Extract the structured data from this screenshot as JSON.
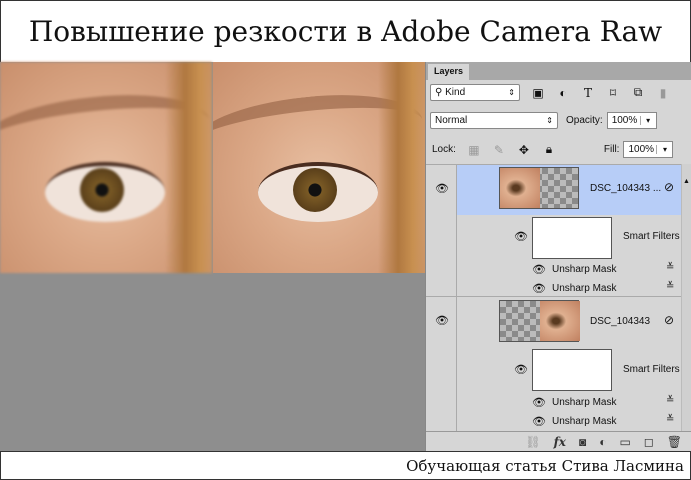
{
  "title": "Повышение резкости в Adobe Camera Raw",
  "caption": "Обучающая статья Стива Ласмина",
  "panel": {
    "tab": "Layers",
    "filter": "Kind",
    "blend_mode": "Normal",
    "opacity_label": "Opacity:",
    "opacity": "100%",
    "lock_label": "Lock:",
    "fill_label": "Fill:",
    "fill": "100%",
    "layers": [
      {
        "name": "DSC_104343 ...",
        "selected": true,
        "smart_filters": "Smart Filters",
        "filters": [
          "Unsharp Mask",
          "Unsharp Mask"
        ]
      },
      {
        "name": "DSC_104343",
        "selected": false,
        "smart_filters": "Smart Filters",
        "filters": [
          "Unsharp Mask",
          "Unsharp Mask"
        ]
      }
    ]
  },
  "colors": {
    "selected": "#b7cdf7",
    "panel": "#d6d6d6",
    "canvas": "#8e8e8e"
  }
}
